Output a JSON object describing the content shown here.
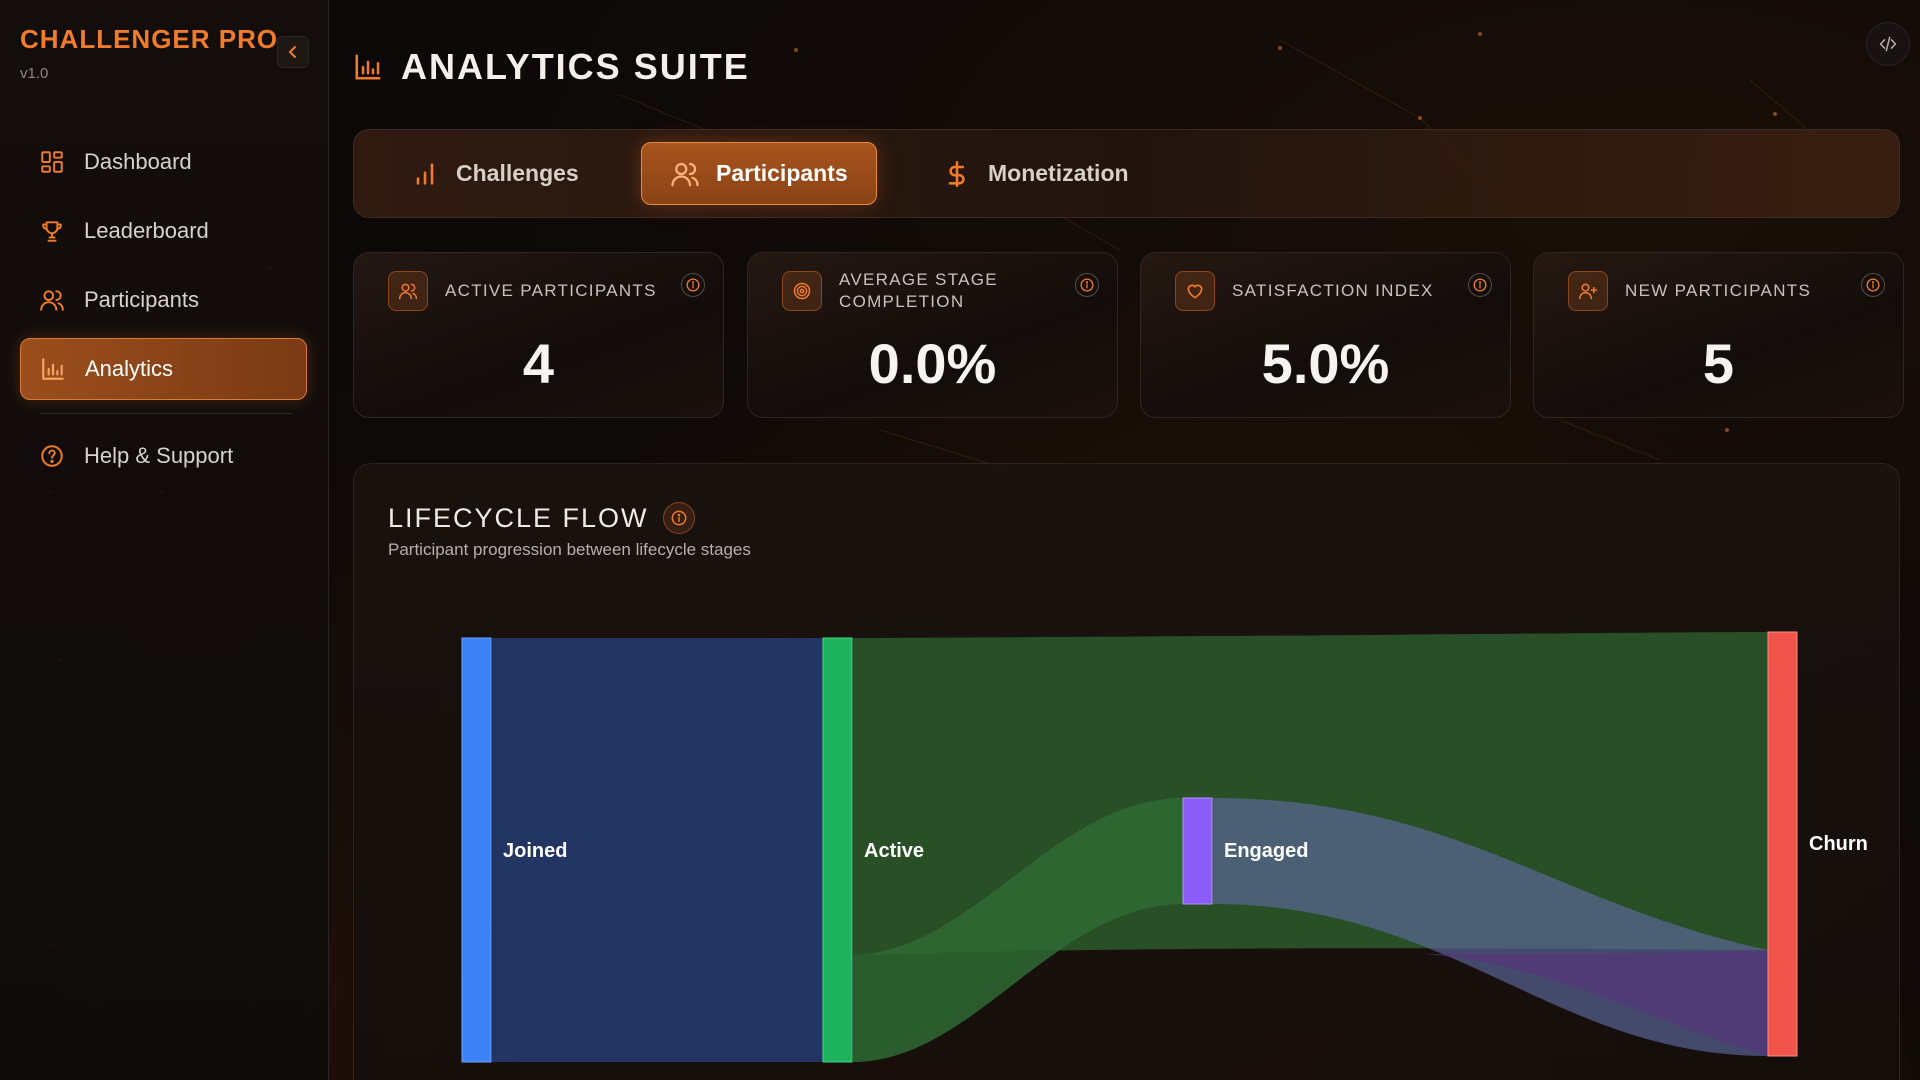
{
  "brand": {
    "title": "CHALLENGER PRO",
    "version": "v1.0"
  },
  "sidebar": {
    "items": [
      {
        "label": "Dashboard",
        "icon": "dashboard-icon"
      },
      {
        "label": "Leaderboard",
        "icon": "trophy-icon"
      },
      {
        "label": "Participants",
        "icon": "users-icon"
      },
      {
        "label": "Analytics",
        "icon": "bar-chart-icon",
        "active": true
      },
      {
        "label": "Help & Support",
        "icon": "help-icon"
      }
    ]
  },
  "header": {
    "title": "ANALYTICS SUITE"
  },
  "tabs": [
    {
      "label": "Challenges",
      "icon": "bar-chart-icon"
    },
    {
      "label": "Participants",
      "icon": "users-icon",
      "active": true
    },
    {
      "label": "Monetization",
      "icon": "dollar-icon"
    }
  ],
  "stats": [
    {
      "label": "ACTIVE PARTICIPANTS",
      "value": "4",
      "icon": "users-icon"
    },
    {
      "label": "AVERAGE STAGE COMPLETION",
      "value": "0.0%",
      "icon": "target-icon"
    },
    {
      "label": "SATISFACTION INDEX",
      "value": "5.0%",
      "icon": "heart-icon"
    },
    {
      "label": "NEW PARTICIPANTS",
      "value": "5",
      "icon": "user-plus-icon"
    }
  ],
  "lifecycle": {
    "title": "LIFECYCLE FLOW",
    "subtitle": "Participant progression between lifecycle stages",
    "nodes": [
      {
        "name": "Joined",
        "color": "#3b82f6"
      },
      {
        "name": "Active",
        "color": "#1db35e"
      },
      {
        "name": "Engaged",
        "color": "#8b5cf6"
      },
      {
        "name": "Churn",
        "color": "#f0544a"
      }
    ]
  },
  "colors": {
    "accent": "#f07b2b"
  }
}
